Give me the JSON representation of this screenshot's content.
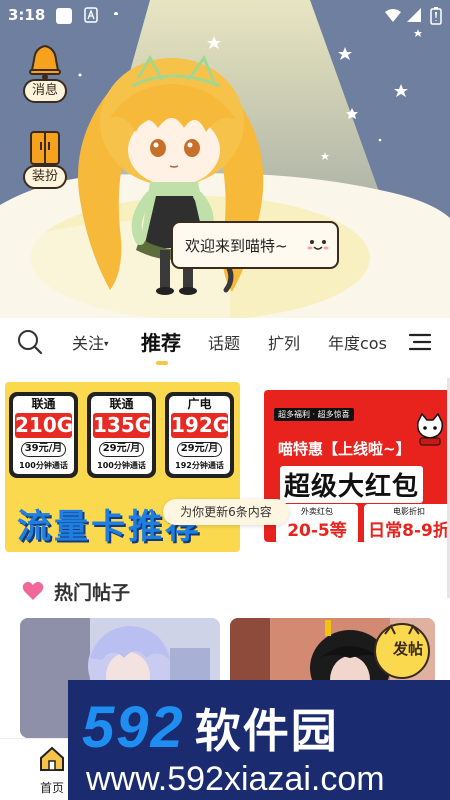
{
  "status_bar": {
    "time": "3:18"
  },
  "hero": {
    "message_label": "消息",
    "dress_label": "装扮",
    "welcome_text": "欢迎来到喵特~"
  },
  "tabs": {
    "items": [
      "关注",
      "推荐",
      "话题",
      "扩列",
      "年度cos"
    ],
    "active": "推荐",
    "follow_has_dropdown": true
  },
  "banner_left": {
    "sims": [
      {
        "brand": "联通",
        "gb": "210G",
        "price": "39元/月",
        "calls": "100分钟通话"
      },
      {
        "brand": "联通",
        "gb": "135G",
        "price": "29元/月",
        "calls": "100分钟通话"
      },
      {
        "brand": "广电",
        "gb": "192G",
        "price": "29元/月",
        "calls": "192分钟通话"
      }
    ],
    "slogan": "流量卡推荐"
  },
  "banner_right": {
    "top_badge": "超多福利 · 超多惊喜",
    "title1": "喵特惠【上线啦~】",
    "title2": "超级大红包",
    "boxes": [
      {
        "line1": "外卖红包",
        "line2": "20-5等"
      },
      {
        "line1": "电影折扣",
        "line2": "日常8-9折"
      }
    ]
  },
  "toast": "为你更新6条内容",
  "section": {
    "title": "热门帖子"
  },
  "posts": [
    {
      "badge": ""
    },
    {
      "badge": "发帖"
    }
  ],
  "watermark": {
    "number": "592",
    "name": "软件园",
    "url": "www.592xiazai.com"
  },
  "bottom_nav": {
    "home_label": "首页"
  },
  "colors": {
    "accent": "#f5c64a",
    "hero_sky": "#6e7f9f",
    "red_banner": "#e8231d",
    "yellow_banner": "#fbd94e",
    "watermark_blue": "#1e8ff0"
  }
}
